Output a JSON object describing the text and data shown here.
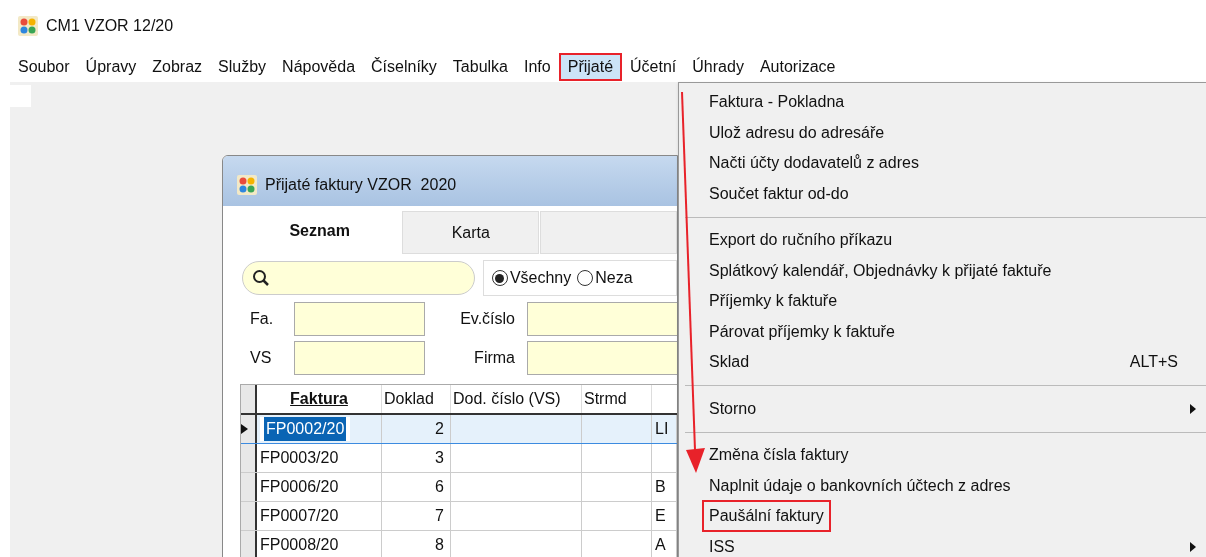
{
  "app_title": "CM1 VZOR 12/20",
  "menu_bar": [
    {
      "label": "Soubor",
      "selected": false
    },
    {
      "label": "Úpravy",
      "selected": false
    },
    {
      "label": "Zobraz",
      "selected": false
    },
    {
      "label": "Služby",
      "selected": false
    },
    {
      "label": "Nápověda",
      "selected": false
    },
    {
      "label": "Číselníky",
      "selected": false
    },
    {
      "label": "Tabulka",
      "selected": false
    },
    {
      "label": "Info",
      "selected": false
    },
    {
      "label": "Přijaté",
      "selected": true
    },
    {
      "label": "Účetní",
      "selected": false
    },
    {
      "label": "Úhrady",
      "selected": false
    },
    {
      "label": "Autorizace",
      "selected": false
    }
  ],
  "dropdown": [
    {
      "kind": "item",
      "label": "Faktura - Pokladna",
      "highlighted": false
    },
    {
      "kind": "item",
      "label": "Ulož adresu do adresáře",
      "highlighted": false
    },
    {
      "kind": "item",
      "label": "Načti účty dodavatelů z adres",
      "highlighted": false
    },
    {
      "kind": "item",
      "label": "Součet faktur od-do",
      "highlighted": false
    },
    {
      "kind": "separator"
    },
    {
      "kind": "item",
      "label": "Export do ručního příkazu",
      "highlighted": false
    },
    {
      "kind": "item",
      "label": "Splátkový kalendář, Objednávky k přijaté faktuře",
      "highlighted": false
    },
    {
      "kind": "item",
      "label": "Příjemky k faktuře",
      "highlighted": false
    },
    {
      "kind": "item",
      "label": "Párovat příjemky k faktuře",
      "highlighted": false
    },
    {
      "kind": "item",
      "label": "Sklad",
      "shortcut": "ALT+S",
      "highlighted": false
    },
    {
      "kind": "separator"
    },
    {
      "kind": "submenu",
      "label": "Storno",
      "highlighted": false
    },
    {
      "kind": "separator"
    },
    {
      "kind": "item",
      "label": "Změna čísla faktury",
      "highlighted": false
    },
    {
      "kind": "item",
      "label": "Naplnit údaje o bankovních účtech z adres",
      "highlighted": false
    },
    {
      "kind": "item",
      "label": "Paušální faktury",
      "highlighted": true
    },
    {
      "kind": "submenu",
      "label": "ISS",
      "highlighted": false
    }
  ],
  "window": {
    "title": "Přijaté faktury VZOR  2020",
    "tabs": [
      {
        "label": "Seznam",
        "selected": true
      },
      {
        "label": "Karta",
        "selected": false
      },
      {
        "selected": false
      }
    ],
    "filter": [
      {
        "label": "Všechny",
        "selected": true
      },
      {
        "label": "Neza",
        "selected": false
      }
    ],
    "fields": [
      {
        "label": "Fa."
      },
      {
        "label": "Ev.číslo"
      },
      {
        "label": "VS"
      },
      {
        "label": "Firma"
      }
    ],
    "table": {
      "columns": [
        "Faktura",
        "Doklad",
        "Dod. číslo (VS)",
        "Strmd"
      ],
      "rows": [
        {
          "cells": [
            "FP0002/20",
            "2",
            "",
            "",
            "LI"
          ],
          "selected": true
        },
        {
          "cells": [
            "FP0003/20",
            "3",
            "",
            "",
            ""
          ],
          "selected": false
        },
        {
          "cells": [
            "FP0006/20",
            "6",
            "",
            "",
            "B"
          ],
          "selected": false
        },
        {
          "cells": [
            "FP0007/20",
            "7",
            "",
            "",
            "E"
          ],
          "selected": false
        },
        {
          "cells": [
            "FP0008/20",
            "8",
            "",
            "",
            "A"
          ],
          "selected": false
        }
      ]
    }
  }
}
